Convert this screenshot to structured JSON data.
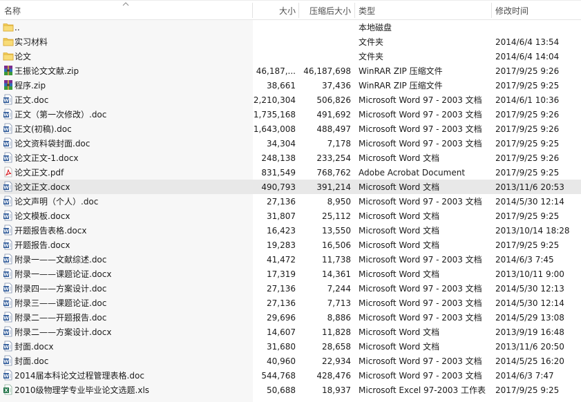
{
  "columns": {
    "name": "名称",
    "size": "大小",
    "packed": "压缩后大小",
    "type": "类型",
    "modified": "修改时间"
  },
  "colors": {
    "folder": "#f3cf5a",
    "word": "#2b5797",
    "pdf": "#d8232a",
    "excel": "#1e7145",
    "selected_row": "#e8e8e8"
  },
  "files": [
    {
      "icon": "folder-icon",
      "name": "..",
      "size": "",
      "packed": "",
      "type": "本地磁盘",
      "modified": ""
    },
    {
      "icon": "folder-icon",
      "name": "实习材料",
      "size": "",
      "packed": "",
      "type": "文件夹",
      "modified": "2014/6/4 13:54"
    },
    {
      "icon": "folder-icon",
      "name": "论文",
      "size": "",
      "packed": "",
      "type": "文件夹",
      "modified": "2014/6/4 14:04"
    },
    {
      "icon": "winrar-archive-icon",
      "name": "王振论文文献.zip",
      "size": "46,187,...",
      "packed": "46,187,698",
      "type": "WinRAR ZIP 压缩文件",
      "modified": "2017/9/25 9:26"
    },
    {
      "icon": "winrar-archive-icon",
      "name": "程序.zip",
      "size": "38,661",
      "packed": "37,436",
      "type": "WinRAR ZIP 压缩文件",
      "modified": "2017/9/25 9:25"
    },
    {
      "icon": "word-document-icon",
      "name": "正文.doc",
      "size": "2,210,304",
      "packed": "506,826",
      "type": "Microsoft Word 97 - 2003 文档",
      "modified": "2014/6/1 10:36"
    },
    {
      "icon": "word-document-icon",
      "name": "正文（第一次修改）.doc",
      "size": "1,735,168",
      "packed": "491,692",
      "type": "Microsoft Word 97 - 2003 文档",
      "modified": "2017/9/25 9:26"
    },
    {
      "icon": "word-document-icon",
      "name": "正文(初稿).doc",
      "size": "1,643,008",
      "packed": "488,497",
      "type": "Microsoft Word 97 - 2003 文档",
      "modified": "2017/9/25 9:26"
    },
    {
      "icon": "word-document-icon",
      "name": "论文资料袋封面.doc",
      "size": "34,304",
      "packed": "7,178",
      "type": "Microsoft Word 97 - 2003 文档",
      "modified": "2017/9/25 9:25"
    },
    {
      "icon": "word-document-icon",
      "name": "论文正文-1.docx",
      "size": "248,138",
      "packed": "233,254",
      "type": "Microsoft Word 文档",
      "modified": "2017/9/25 9:26"
    },
    {
      "icon": "pdf-document-icon",
      "name": "论文正文.pdf",
      "size": "831,549",
      "packed": "768,762",
      "type": "Adobe Acrobat Document",
      "modified": "2017/9/25 9:25"
    },
    {
      "icon": "word-document-icon",
      "name": "论文正文.docx",
      "size": "490,793",
      "packed": "391,214",
      "type": "Microsoft Word 文档",
      "modified": "2013/11/6 20:53",
      "selected": true
    },
    {
      "icon": "word-document-icon",
      "name": "论文声明（个人）.doc",
      "size": "27,136",
      "packed": "8,950",
      "type": "Microsoft Word 97 - 2003 文档",
      "modified": "2014/5/30 12:14"
    },
    {
      "icon": "word-document-icon",
      "name": "论文模板.docx",
      "size": "31,807",
      "packed": "25,112",
      "type": "Microsoft Word 文档",
      "modified": "2017/9/25 9:25"
    },
    {
      "icon": "word-document-icon",
      "name": "开题报告表格.docx",
      "size": "16,423",
      "packed": "13,550",
      "type": "Microsoft Word 文档",
      "modified": "2013/10/14 18:28"
    },
    {
      "icon": "word-document-icon",
      "name": "开题报告.docx",
      "size": "19,283",
      "packed": "16,506",
      "type": "Microsoft Word 文档",
      "modified": "2017/9/25 9:25"
    },
    {
      "icon": "word-document-icon",
      "name": "附录一——文献综述.doc",
      "size": "41,472",
      "packed": "11,738",
      "type": "Microsoft Word 97 - 2003 文档",
      "modified": "2014/6/3 7:45"
    },
    {
      "icon": "word-document-icon",
      "name": "附录一——课题论证.docx",
      "size": "17,319",
      "packed": "14,361",
      "type": "Microsoft Word 文档",
      "modified": "2013/10/11 9:00"
    },
    {
      "icon": "word-document-icon",
      "name": "附录四——方案设计.doc",
      "size": "27,136",
      "packed": "7,244",
      "type": "Microsoft Word 97 - 2003 文档",
      "modified": "2014/5/30 12:13"
    },
    {
      "icon": "word-document-icon",
      "name": "附录三——课题论证.doc",
      "size": "27,136",
      "packed": "7,713",
      "type": "Microsoft Word 97 - 2003 文档",
      "modified": "2014/5/30 12:14"
    },
    {
      "icon": "word-document-icon",
      "name": "附录二——开题报告.doc",
      "size": "29,696",
      "packed": "8,886",
      "type": "Microsoft Word 97 - 2003 文档",
      "modified": "2014/5/29 13:08"
    },
    {
      "icon": "word-document-icon",
      "name": "附录二——方案设计.docx",
      "size": "14,607",
      "packed": "11,828",
      "type": "Microsoft Word 文档",
      "modified": "2013/9/19 16:48"
    },
    {
      "icon": "word-document-icon",
      "name": "封面.docx",
      "size": "31,680",
      "packed": "28,658",
      "type": "Microsoft Word 文档",
      "modified": "2013/11/6 20:50"
    },
    {
      "icon": "word-document-icon",
      "name": "封面.doc",
      "size": "40,960",
      "packed": "22,934",
      "type": "Microsoft Word 97 - 2003 文档",
      "modified": "2014/5/25 16:20"
    },
    {
      "icon": "word-document-icon",
      "name": "2014届本科论文过程管理表格.doc",
      "size": "544,768",
      "packed": "428,476",
      "type": "Microsoft Word 97 - 2003 文档",
      "modified": "2014/6/3 7:47"
    },
    {
      "icon": "excel-spreadsheet-icon",
      "name": "2010级物理学专业毕业论文选题.xls",
      "size": "50,688",
      "packed": "18,937",
      "type": "Microsoft Excel 97-2003 工作表",
      "modified": "2017/9/25 9:25"
    }
  ]
}
